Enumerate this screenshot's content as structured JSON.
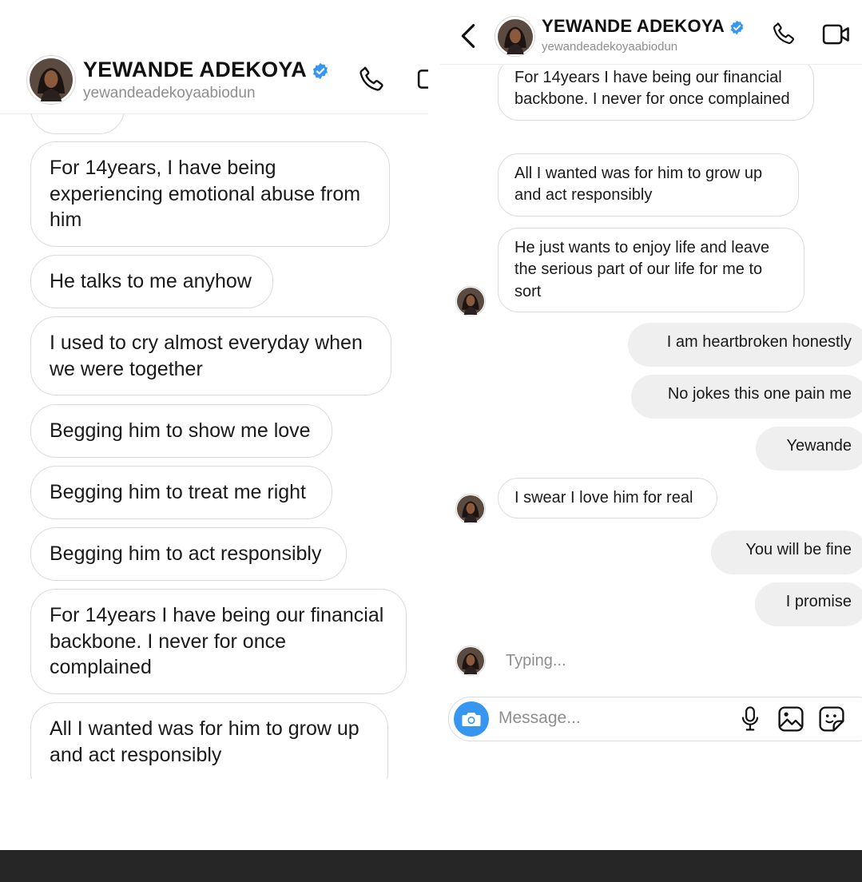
{
  "contact": {
    "name": "YEWANDE ADEKOYA",
    "username": "yewandeadekoyaabiodun"
  },
  "icons": {
    "back": "chevron-left-icon",
    "verified": "verified-badge-icon",
    "call": "phone-icon",
    "video": "video-camera-icon",
    "camera": "camera-icon",
    "mic": "microphone-icon",
    "gallery": "image-icon",
    "sticker": "sticker-icon"
  },
  "colors": {
    "verified": "#3797f0",
    "camera_button": "#3797f0",
    "outgoing_bubble": "#efefef",
    "incoming_border": "#dbdbdb",
    "footer": "#262626"
  },
  "left_panel": {
    "messages": [
      {
        "text": "For 14years, I have being experiencing emotional abuse from him"
      },
      {
        "text": "He talks to me anyhow"
      },
      {
        "text": "I used to cry almost everyday when we were together"
      },
      {
        "text": "Begging him to show me love"
      },
      {
        "text": "Begging him to treat me right"
      },
      {
        "text": "Begging him to act responsibly"
      },
      {
        "text": "For 14years I have being our financial backbone. I never for once complained"
      },
      {
        "text": "All I wanted was for him to grow up and act responsibly"
      }
    ]
  },
  "right_panel": {
    "messages": [
      {
        "text": "For 14years I have being our financial backbone. I never for once complained",
        "sender": "them"
      },
      {
        "text": "All I wanted was for him to grow up and act responsibly",
        "sender": "them"
      },
      {
        "text": "He just wants to enjoy life and leave the serious part of our life for me to sort",
        "sender": "them"
      },
      {
        "text": "I am heartbroken honestly",
        "sender": "me"
      },
      {
        "text": "No jokes this one pain me",
        "sender": "me"
      },
      {
        "text": "Yewande",
        "sender": "me"
      },
      {
        "text": "I swear I love him for real",
        "sender": "them"
      },
      {
        "text": "You will be fine",
        "sender": "me"
      },
      {
        "text": "I promise",
        "sender": "me"
      }
    ],
    "typing": "Typing...",
    "composer_placeholder": "Message..."
  }
}
